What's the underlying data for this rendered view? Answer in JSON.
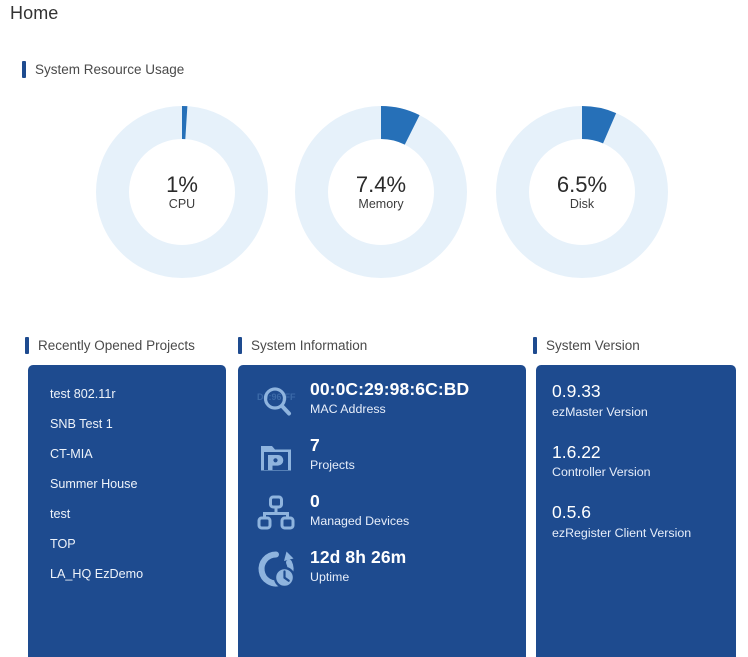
{
  "page": {
    "title": "Home"
  },
  "resource_section": {
    "title": "System Resource Usage"
  },
  "chart_data": {
    "type": "pie",
    "title": "System Resource Usage",
    "legend": "none",
    "charts": [
      {
        "name": "cpu",
        "label": "CPU",
        "value": 1,
        "display": "1%",
        "max": 100,
        "track_color": "#e6f1fa",
        "fill_color": "#2670b8"
      },
      {
        "name": "memory",
        "label": "Memory",
        "value": 7.4,
        "display": "7.4%",
        "max": 100,
        "track_color": "#e6f1fa",
        "fill_color": "#2670b8"
      },
      {
        "name": "disk",
        "label": "Disk",
        "value": 6.5,
        "display": "6.5%",
        "max": 100,
        "track_color": "#e6f1fa",
        "fill_color": "#2670b8"
      }
    ]
  },
  "recent_projects": {
    "title": "Recently Opened Projects",
    "items": [
      "test 802.11r",
      "SNB Test 1",
      "CT-MIA",
      "Summer House",
      "test",
      "TOP",
      "LA_HQ EzDemo"
    ]
  },
  "system_information": {
    "title": "System Information",
    "rows": [
      {
        "icon": "mac-address-icon",
        "value": "00:0C:29:98:6C:BD",
        "label": "MAC Address"
      },
      {
        "icon": "projects-folder-icon",
        "value": "7",
        "label": "Projects"
      },
      {
        "icon": "managed-devices-icon",
        "value": "0",
        "label": "Managed Devices"
      },
      {
        "icon": "uptime-icon",
        "value": "12d 8h 26m",
        "label": "Uptime"
      }
    ]
  },
  "system_version": {
    "title": "System Version",
    "rows": [
      {
        "value": "0.9.33",
        "label": "ezMaster Version"
      },
      {
        "value": "1.6.22",
        "label": "Controller Version"
      },
      {
        "value": "0.5.6",
        "label": "ezRegister Client Version"
      }
    ]
  },
  "colors": {
    "panel_blue": "#1e4b8f",
    "accent_blue": "#2670b8",
    "track_blue": "#e6f1fa",
    "page_background": "#ffffff"
  }
}
